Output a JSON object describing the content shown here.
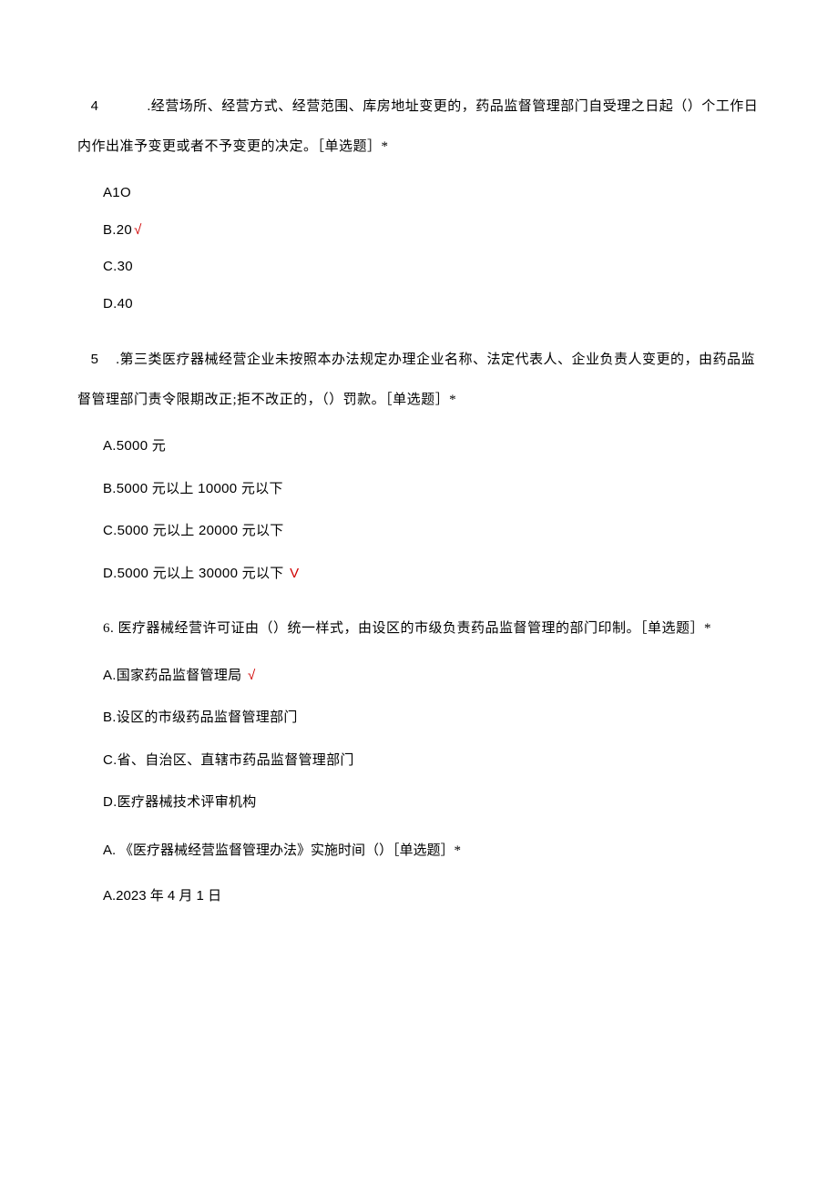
{
  "q4": {
    "num": "4",
    "dot": ".",
    "text": "经营场所、经营方式、经营范围、库房地址变更的，药品监督管理部门自受理之日起（）个工作日内作出准予变更或者不予变更的决定。［单选题］*",
    "A": "A1O",
    "B": "B.20",
    "B_mark": "√",
    "C": "C.30",
    "D": "D.40"
  },
  "q5": {
    "num": "5",
    "dot": ".",
    "text": "第三类医疗器械经营企业未按照本办法规定办理企业名称、法定代表人、企业负责人变更的，由药品监督管理部门责令限期改正;拒不改正的，（）罚款。［单选题］*",
    "A": "A.5000 元",
    "B": "B.5000 元以上 10000 元以下",
    "C": "C.5000 元以上 20000 元以下",
    "D": "D.5000 元以上 30000 元以下",
    "D_mark": "V"
  },
  "q6": {
    "num": "6.",
    "text": " 医疗器械经营许可证由（）统一样式，由设区的市级负责药品监督管理的部门印制。［单选题］*",
    "A": "A.国家药品监督管理局",
    "A_mark": "√",
    "B": "B.设区的市级药品监督管理部门",
    "C": "C.省、自治区、直辖市药品监督管理部门",
    "D": "D.医疗器械技术评审机构"
  },
  "q7": {
    "prefix": "A.",
    "text": "  《医疗器械经营监督管理办法》实施时间（）［单选题］*",
    "A": "A.2023 年 4 月 1 日"
  }
}
